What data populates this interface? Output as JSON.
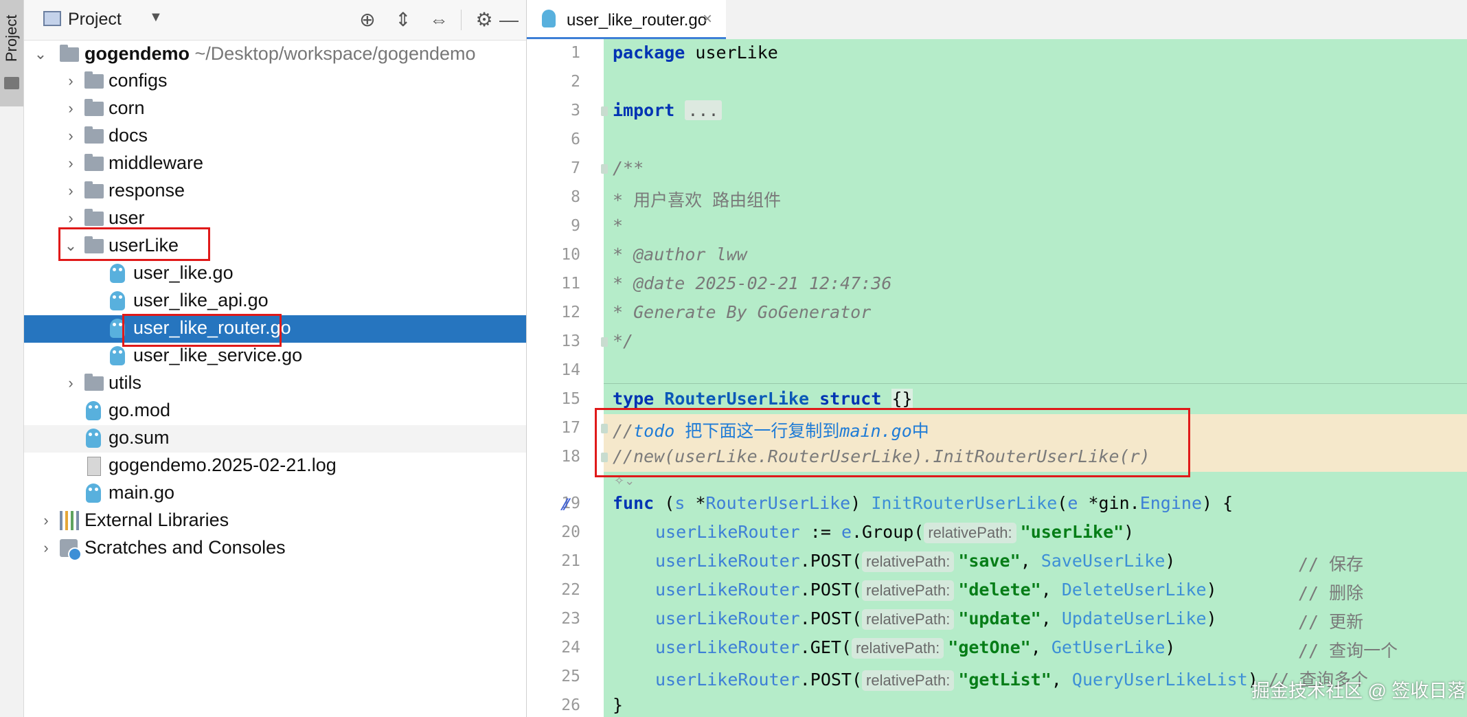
{
  "side_strip": {
    "label": "Project"
  },
  "panel": {
    "title": "Project",
    "tree": [
      {
        "label": "gogendemo",
        "path": "~/Desktop/workspace/gogendemo",
        "icon": "module-folder-icon",
        "expanded": true
      },
      {
        "label": "configs",
        "icon": "folder-icon"
      },
      {
        "label": "corn",
        "icon": "folder-icon"
      },
      {
        "label": "docs",
        "icon": "folder-icon"
      },
      {
        "label": "middleware",
        "icon": "folder-icon"
      },
      {
        "label": "response",
        "icon": "folder-icon"
      },
      {
        "label": "user",
        "icon": "folder-icon"
      },
      {
        "label": "userLike",
        "icon": "folder-icon",
        "expanded": true
      },
      {
        "label": "user_like.go",
        "icon": "go-file-icon"
      },
      {
        "label": "user_like_api.go",
        "icon": "go-file-icon"
      },
      {
        "label": "user_like_router.go",
        "icon": "go-file-icon",
        "selected": true
      },
      {
        "label": "user_like_service.go",
        "icon": "go-file-icon"
      },
      {
        "label": "utils",
        "icon": "folder-icon"
      },
      {
        "label": "go.mod",
        "icon": "go-mod-icon"
      },
      {
        "label": "go.sum",
        "icon": "go-sum-icon"
      },
      {
        "label": "gogendemo.2025-02-21.log",
        "icon": "log-file-icon"
      },
      {
        "label": "main.go",
        "icon": "go-file-icon"
      },
      {
        "label": "External Libraries",
        "icon": "libraries-icon"
      },
      {
        "label": "Scratches and Consoles",
        "icon": "scratches-icon"
      }
    ]
  },
  "editor": {
    "tab": {
      "label": "user_like_router.go",
      "close": "×"
    },
    "line_numbers": [
      "1",
      "2",
      "3",
      "6",
      "7",
      "8",
      "9",
      "10",
      "11",
      "12",
      "13",
      "14",
      "15",
      "17",
      "18",
      "19",
      "20",
      "21",
      "22",
      "23",
      "24",
      "25",
      "26"
    ],
    "lines": {
      "l1": {
        "kw": "package",
        "rest": " userLike"
      },
      "l3": {
        "kw": "import",
        "dots": "..."
      },
      "l7": "/**",
      "l8": "* 用户喜欢 路由组件",
      "l9": "*",
      "l10": "* @author lww",
      "l11": "* @date 2025-02-21 12:47:36",
      "l12": "* Generate By GoGenerator",
      "l13": "*/",
      "l15": {
        "kw1": "type",
        "name": "RouterUserLike",
        "kw2": "struct",
        "braces": "{}"
      },
      "l17": {
        "prefix": "//",
        "todo": "todo",
        "text": " 把下面这一行复制到",
        "main": "main.go",
        "suffix": "中"
      },
      "l18": "//new(userLike.RouterUserLike).InitRouterUserLike(r)",
      "l19": {
        "kw": "func",
        "p1": " (",
        "recv": "s",
        "p2": " *",
        "recvType": "RouterUserLike",
        "p3": ") ",
        "fname": "InitRouterUserLike",
        "p4": "(",
        "arg": "e",
        "p5": " *gin.",
        "argType": "Engine",
        "p6": ") {"
      },
      "l20": {
        "var": "userLikeRouter",
        "op": " := ",
        "recv": "e",
        "call": ".Group(",
        "hint": "relativePath:",
        "str": "\"userLike\"",
        "end": ")"
      },
      "l21": {
        "var": "userLikeRouter",
        "call": ".POST(",
        "hint": "relativePath:",
        "str": "\"save\"",
        "comma": ", ",
        "fn": "SaveUserLike",
        "end": ")",
        "comment": "// 保存"
      },
      "l22": {
        "var": "userLikeRouter",
        "call": ".POST(",
        "hint": "relativePath:",
        "str": "\"delete\"",
        "comma": ", ",
        "fn": "DeleteUserLike",
        "end": ")",
        "comment": "// 删除"
      },
      "l23": {
        "var": "userLikeRouter",
        "call": ".POST(",
        "hint": "relativePath:",
        "str": "\"update\"",
        "comma": ", ",
        "fn": "UpdateUserLike",
        "end": ")",
        "comment": "// 更新"
      },
      "l24": {
        "var": "userLikeRouter",
        "call": ".GET(",
        "hint": "relativePath:",
        "str": "\"getOne\"",
        "comma": ", ",
        "fn": "GetUserLike",
        "end": ")",
        "comment": "// 查询一个"
      },
      "l25": {
        "var": "userLikeRouter",
        "call": ".POST(",
        "hint": "relativePath:",
        "str": "\"getList\"",
        "comma": ", ",
        "fn": "QueryUserLikeList",
        "end": ")",
        "comment": "// 查询多个"
      },
      "l26": "}"
    }
  },
  "watermark": "掘金技术社区 @ 签收日落",
  "colors": {
    "selection": "#2675bf",
    "code_bg": "#b5ecc9",
    "todo_band": "#f5e8cb",
    "highlight_box": "#e01919",
    "keyword": "#0033b3"
  }
}
